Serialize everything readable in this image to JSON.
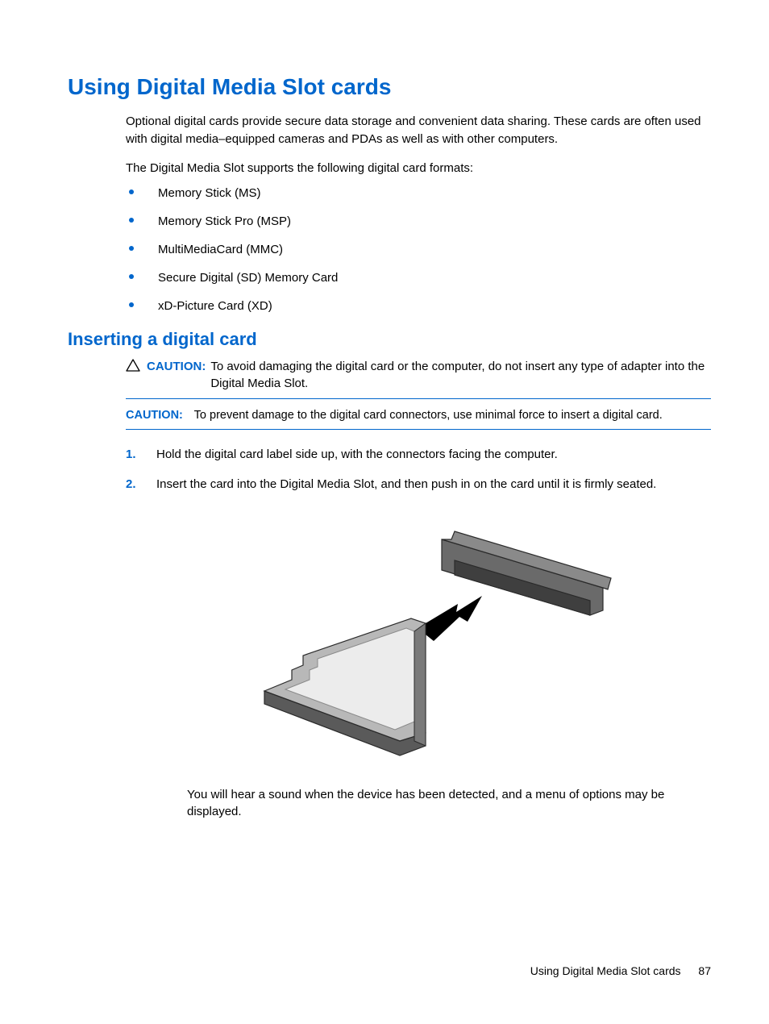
{
  "heading": "Using Digital Media Slot cards",
  "intro1": "Optional digital cards provide secure data storage and convenient data sharing. These cards are often used with digital media–equipped cameras and PDAs as well as with other computers.",
  "intro2": "The Digital Media Slot supports the following digital card formats:",
  "bullets": [
    "Memory Stick (MS)",
    "Memory Stick Pro (MSP)",
    "MultiMediaCard (MMC)",
    "Secure Digital (SD) Memory Card",
    "xD-Picture Card (XD)"
  ],
  "subheading": "Inserting a digital card",
  "caution_label": "CAUTION:",
  "caution1": "To avoid damaging the digital card or the computer, do not insert any type of adapter into the Digital Media Slot.",
  "caution2": "To prevent damage to the digital card connectors, use minimal force to insert a digital card.",
  "steps": {
    "s1_num": "1.",
    "s1_text": "Hold the digital card label side up, with the connectors facing the computer.",
    "s2_num": "2.",
    "s2_text": "Insert the card into the Digital Media Slot, and then push in on the card until it is firmly seated."
  },
  "after_text": "You will hear a sound when the device has been detected, and a menu of options may be displayed.",
  "footer_title": "Using Digital Media Slot cards",
  "footer_page": "87"
}
